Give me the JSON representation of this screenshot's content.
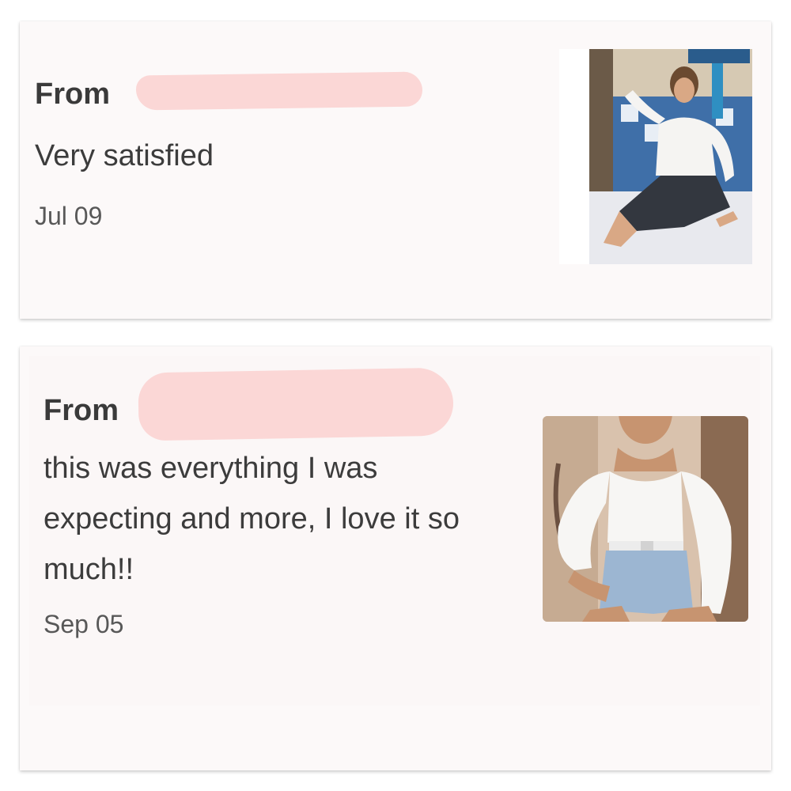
{
  "reviews": [
    {
      "from_label": "From",
      "text": "Very satisfied",
      "date": "Jul 09",
      "photo_icon": "review-photo-woman-white-blouse-dark-jeans"
    },
    {
      "from_label": "From",
      "text": "this was everything I was expecting and more, I love it so much!!",
      "date": "Sep 05",
      "photo_icon": "review-photo-woman-white-blouse-denim-shorts"
    }
  ],
  "colors": {
    "redaction": "#fbd7d6",
    "card_background": "#fcf9f9",
    "text_primary": "#3a3a3a",
    "text_secondary": "#585858"
  }
}
